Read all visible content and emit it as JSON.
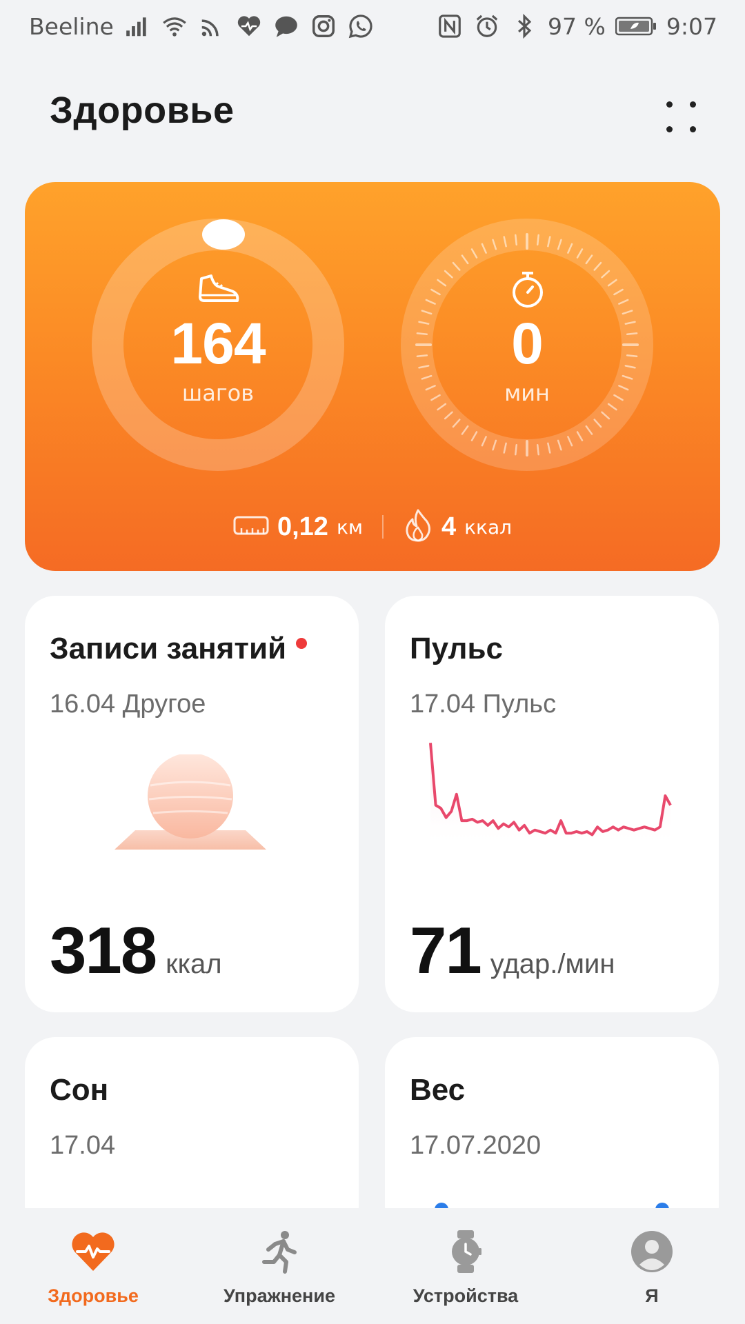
{
  "status_bar": {
    "carrier": "Beeline",
    "battery": "97 %",
    "time": "9:07",
    "left_icons": [
      "signal-icon",
      "wifi-icon",
      "cast-icon",
      "health-icon",
      "chat-icon",
      "instagram-icon",
      "whatsapp-icon"
    ],
    "right_icons": [
      "nfc-icon",
      "alarm-icon",
      "bluetooth-icon",
      "battery-icon"
    ]
  },
  "header": {
    "title": "Здоровье",
    "more_icon": "more-dots-icon"
  },
  "activity": {
    "steps_value": "164",
    "steps_unit": "шагов",
    "minutes_value": "0",
    "minutes_unit": "мин",
    "distance_value": "0,12",
    "distance_unit": "км",
    "calories_value": "4",
    "calories_unit": "ккал",
    "colors": {
      "top": "#ffa22b",
      "bottom": "#f56b24"
    }
  },
  "tiles": {
    "workouts": {
      "title": "Записи занятий",
      "subtitle": "16.04 Другое",
      "value": "318",
      "unit": "ккал",
      "has_new": true
    },
    "pulse": {
      "title": "Пульс",
      "subtitle": "17.04 Пульс",
      "value": "71",
      "unit": "удар./мин",
      "sparkline": [
        130,
        90,
        88,
        82,
        86,
        97,
        80,
        80,
        81,
        79,
        80,
        77,
        80,
        75,
        78,
        76,
        79,
        74,
        77,
        72,
        74,
        73,
        72,
        74,
        72,
        80,
        72,
        72,
        73,
        72,
        73,
        71,
        76,
        73,
        74,
        76,
        74,
        76,
        75,
        74,
        75,
        76,
        75,
        74,
        76,
        96,
        90
      ]
    },
    "sleep": {
      "title": "Сон",
      "subtitle": "17.04"
    },
    "weight": {
      "title": "Вес",
      "subtitle": "17.07.2020"
    }
  },
  "nav": {
    "items": [
      {
        "label": "Здоровье",
        "icon": "heart-pulse-icon",
        "active": true
      },
      {
        "label": "Упражнение",
        "icon": "running-icon",
        "active": false
      },
      {
        "label": "Устройства",
        "icon": "watch-icon",
        "active": false
      },
      {
        "label": "Я",
        "icon": "avatar-icon",
        "active": false
      }
    ],
    "active_color": "#f26a1e"
  }
}
